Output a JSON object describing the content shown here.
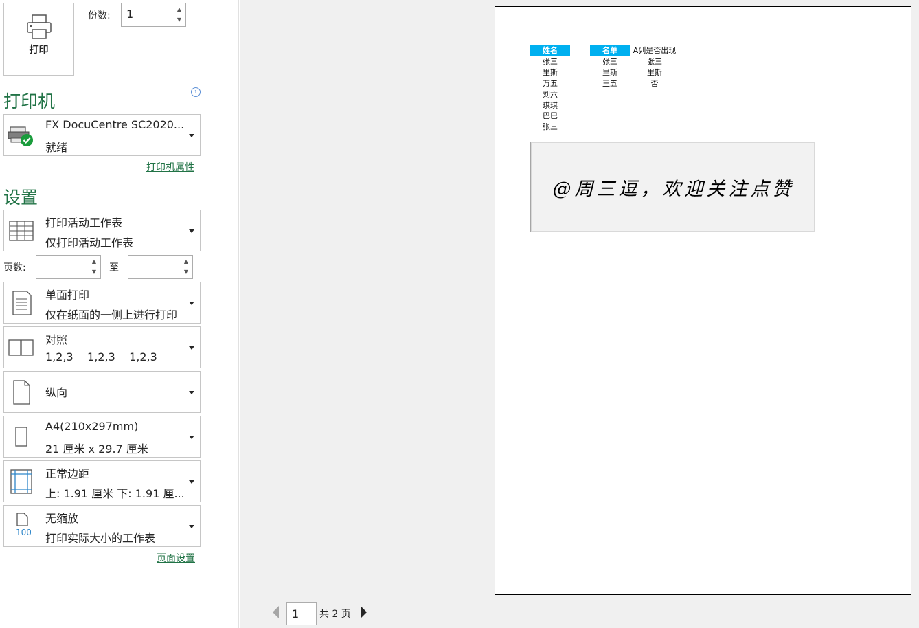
{
  "print_button": {
    "label": "打印",
    "icon": "printer-icon"
  },
  "copies": {
    "label": "份数:",
    "value": "1"
  },
  "printer": {
    "section_title": "打印机",
    "name": "FX DocuCentre SC2020...",
    "status": "就绪",
    "properties_link": "打印机属性",
    "icon": "printer-ready-icon",
    "status_color": "#1a9c3c"
  },
  "settings": {
    "section_title": "设置",
    "scope": {
      "title": "打印活动工作表",
      "subtitle": "仅打印活动工作表",
      "icon": "worksheet-grid-icon"
    },
    "pages": {
      "label": "页数:",
      "to_label": "至",
      "from_value": "",
      "to_value": ""
    },
    "sides": {
      "title": "单面打印",
      "subtitle": "仅在纸面的一侧上进行打印",
      "icon": "single-side-page-icon"
    },
    "collate": {
      "title": "对照",
      "subtitle": "1,2,3    1,2,3    1,2,3",
      "icon": "collate-pages-icon"
    },
    "orientation": {
      "title": "纵向",
      "icon": "portrait-page-icon"
    },
    "paper": {
      "title": "A4(210x297mm)",
      "subtitle": "21 厘米 x 29.7 厘米",
      "icon": "paper-size-icon"
    },
    "margins": {
      "title": "正常边距",
      "subtitle": "上: 1.91 厘米 下: 1.91 厘...",
      "icon": "margins-icon"
    },
    "scaling": {
      "title": "无缩放",
      "subtitle": "打印实际大小的工作表",
      "icon": "no-scaling-icon",
      "icon_text": "100"
    },
    "page_setup_link": "页面设置"
  },
  "preview": {
    "col_name_header": "姓名",
    "col_name": [
      "张三",
      "里斯",
      "万五",
      "刘六",
      "琪琪",
      "巴巴",
      "张三"
    ],
    "list_header": "名单",
    "list": [
      "张三",
      "里斯",
      "王五"
    ],
    "result_header": "A列是否出现",
    "results": [
      "张三",
      "里斯",
      "否"
    ],
    "header_color": "#00b0f0",
    "banner_text": "@周三逗，欢迎关注点赞"
  },
  "navigation": {
    "current_page": "1",
    "total_text": "共 2 页"
  },
  "colors": {
    "accent_green": "#217346",
    "border": "#c6c6c6"
  }
}
